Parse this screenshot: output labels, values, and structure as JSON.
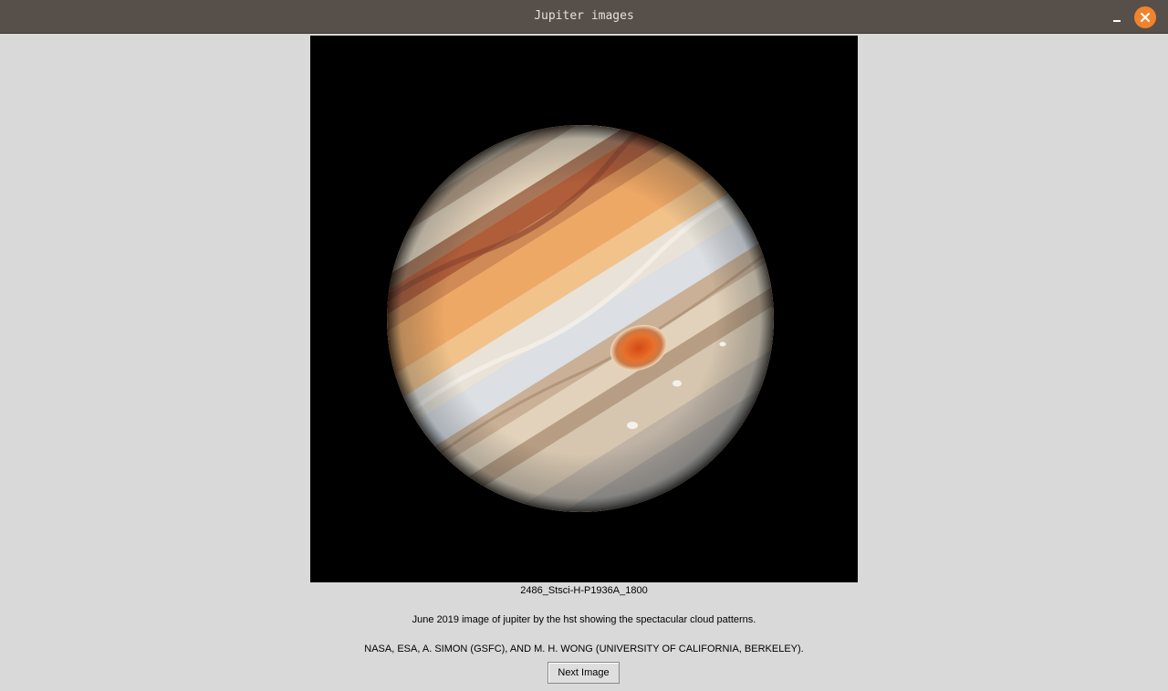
{
  "window": {
    "title": "Jupiter images",
    "controls": {
      "minimize_icon": "minimize-icon",
      "close_icon": "close-icon",
      "close_color": "#f0832c"
    }
  },
  "viewer": {
    "image_subject": "planet-jupiter",
    "filename": "2486_Stsci-H-P1936A_1800",
    "description": "June 2019 image of jupiter by the hst showing the spectacular cloud patterns.",
    "credit": "NASA, ESA, A. SIMON (GSFC), AND M. H. WONG (UNIVERSITY OF CALIFORNIA, BERKELEY).",
    "next_button_label": "Next Image"
  },
  "colors": {
    "titlebar": "#574f4a",
    "background": "#d9d9d9",
    "image_background": "#000000"
  }
}
